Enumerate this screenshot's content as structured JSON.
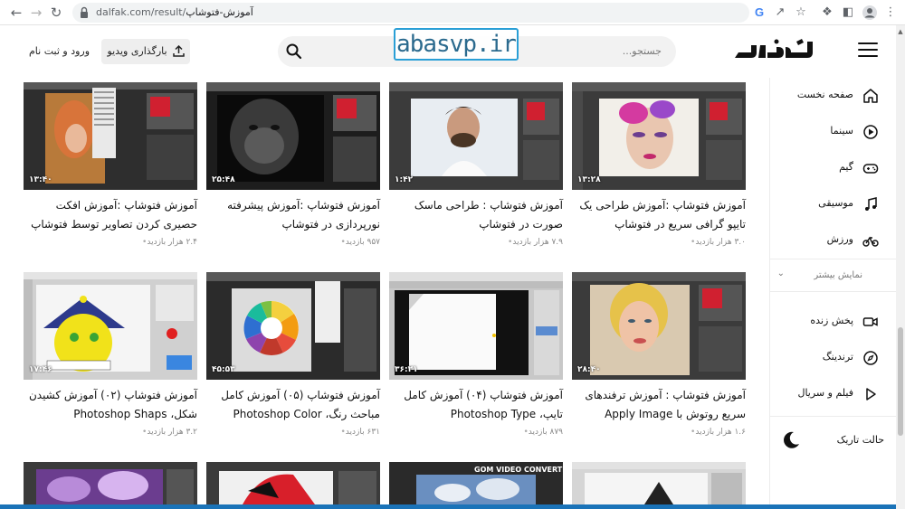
{
  "browser": {
    "url_host": "dalfak.com/result/",
    "url_path": "آموزش-فتوشاپ",
    "google_letter": "G"
  },
  "header": {
    "logo_alt": "دالفک",
    "search_placeholder": "جستجو...",
    "watermark": "abasvp.ir",
    "upload_label": "بارگذاری ویدیو",
    "login_label": "ورود و ثبت نام"
  },
  "sidebar": {
    "items": [
      {
        "label": "صفحه نخست",
        "icon": "home-icon"
      },
      {
        "label": "سینما",
        "icon": "play-circle-icon"
      },
      {
        "label": "گیم",
        "icon": "gamepad-icon"
      },
      {
        "label": "موسیقی",
        "icon": "music-note-icon"
      },
      {
        "label": "ورزش",
        "icon": "bicycle-icon"
      }
    ],
    "more_label": "نمایش بیشتر",
    "items2": [
      {
        "label": "پخش زنده",
        "icon": "live-camera-icon"
      },
      {
        "label": "ترندینگ",
        "icon": "compass-icon"
      },
      {
        "label": "فیلم و سریال",
        "icon": "play-triangle-icon"
      }
    ],
    "dark_mode_label": "حالت تاریک"
  },
  "videos": [
    {
      "title": "آموزش فتوشاپ :آموزش طراحی یک تایپو گرافی سریع در فتوشاپ",
      "views": "۳.۰ هزار بازدید",
      "duration": "۱۳:۲۸"
    },
    {
      "title": "آموزش فتوشاپ : طراحی ماسک صورت در فتوشاپ",
      "views": "۷.۹ هزار بازدید",
      "duration": "۱:۴۲"
    },
    {
      "title": "آموزش فتوشاپ :آموزش پیشرفته نورپردازی در فتوشاپ",
      "views": "۹۵۷ بازدید",
      "duration": "۲۵:۴۸"
    },
    {
      "title": "آموزش فتوشاپ :آموزش افکت حصیری کردن تصاویر توسط فتوشاپ",
      "views": "۲.۴ هزار بازدید",
      "duration": "۱۳:۴۰"
    },
    {
      "title": "آموزش فتوشاپ : آموزش ترفندهای سریع روتوش با Apply Image",
      "views": "۱.۶ هزار بازدید",
      "duration": "۲۸:۴۰"
    },
    {
      "title": "آموزش فتوشاپ (۰۴) آموزش کامل تایپ، Photoshop Type",
      "views": "۸۷۹ بازدید",
      "duration": "۳۶:۲۱"
    },
    {
      "title": "آموزش فتوشاپ (۰۵) آموزش کامل مباحث رنگ، Photoshop Color",
      "views": "۶۳۱ بازدید",
      "duration": "۴۵:۵۳"
    },
    {
      "title": "آموزش فتوشاپ (۰۲) آموزش کشیدن شکل، Photoshop Shaps",
      "views": "۳.۲ هزار بازدید",
      "duration": "۱۷:۴۶"
    },
    {
      "title": "",
      "views": "",
      "duration": ""
    },
    {
      "title": "",
      "views": "",
      "duration": ""
    },
    {
      "title": "",
      "views": "",
      "duration": ""
    },
    {
      "title": "",
      "views": "",
      "duration": ""
    }
  ],
  "thumb_texts": {
    "gom": "GOM VIDEO CONVERTER"
  }
}
